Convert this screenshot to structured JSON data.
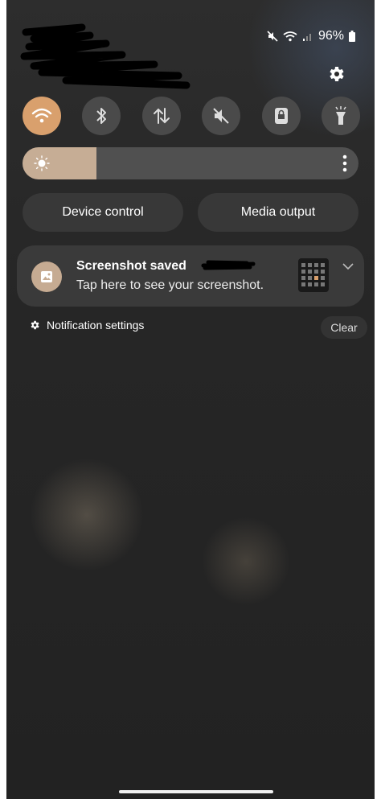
{
  "status_bar": {
    "battery_percent": "96%"
  },
  "quick_tiles": [
    {
      "name": "wifi",
      "icon": "wifi-icon",
      "active": true
    },
    {
      "name": "bluetooth",
      "icon": "bluetooth-icon",
      "active": false
    },
    {
      "name": "mobile-data",
      "icon": "data-arrows-icon",
      "active": false
    },
    {
      "name": "sound",
      "icon": "mute-icon",
      "active": false
    },
    {
      "name": "screen-lock",
      "icon": "lock-icon",
      "active": false
    },
    {
      "name": "flashlight",
      "icon": "flashlight-icon",
      "active": false
    }
  ],
  "brightness": {
    "level": 0.22,
    "icon": "sun-icon"
  },
  "buttons": {
    "device_control": "Device control",
    "media_output": "Media output"
  },
  "notification": {
    "title": "Screenshot saved",
    "body": "Tap here to see your screenshot.",
    "icon": "image-icon"
  },
  "footer": {
    "notification_settings": "Notification settings",
    "clear": "Clear"
  },
  "colors": {
    "accent": "#d9a06d",
    "tile_bg": "#4a4a4a",
    "brightness_fill": "#c6ad95",
    "panel": "#3a3a3a"
  }
}
